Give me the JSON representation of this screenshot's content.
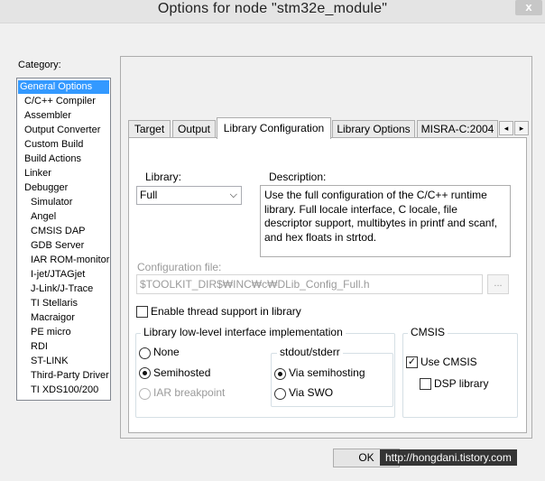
{
  "window": {
    "title": "Options for node \"stm32e_module\"",
    "close_glyph": "x"
  },
  "category": {
    "label": "Category:",
    "items": [
      "General Options",
      "C/C++ Compiler",
      "Assembler",
      "Output Converter",
      "Custom Build",
      "Build Actions",
      "Linker",
      "Debugger",
      "Simulator",
      "Angel",
      "CMSIS DAP",
      "GDB Server",
      "IAR ROM-monitor",
      "I-jet/JTAGjet",
      "J-Link/J-Trace",
      "TI Stellaris",
      "Macraigor",
      "PE micro",
      "RDI",
      "ST-LINK",
      "Third-Party Driver",
      "TI XDS100/200"
    ],
    "selected": "General Options"
  },
  "tabs": {
    "items": [
      "Target",
      "Output",
      "Library Configuration",
      "Library Options",
      "MISRA-C:2004"
    ],
    "active": "Library Configuration",
    "scroll_left": "◂",
    "scroll_right": "▸"
  },
  "library": {
    "label": "Library:",
    "value": "Full",
    "chevron": "⌵"
  },
  "description": {
    "label": "Description:",
    "text": "Use the full configuration of the C/C++ runtime library. Full locale interface, C locale, file descriptor support, multibytes in printf and scanf, and hex floats in strtod."
  },
  "config_file": {
    "label": "Configuration file:",
    "value": "$TOOLKIT_DIR$₩INC₩c₩DLib_Config_Full.h",
    "browse_label": "..."
  },
  "thread_support": {
    "label": "Enable thread support in library",
    "checked": false
  },
  "low_level": {
    "legend": "Library low-level interface implementation",
    "options": [
      "None",
      "Semihosted",
      "IAR breakpoint"
    ],
    "selected": "Semihosted"
  },
  "stdout": {
    "legend": "stdout/stderr",
    "options": [
      "Via semihosting",
      "Via SWO"
    ],
    "selected": "Via semihosting"
  },
  "cmsis": {
    "legend": "CMSIS",
    "use_cmsis_label": "Use CMSIS",
    "use_cmsis_checked": true,
    "dsp_label": "DSP library",
    "dsp_checked": false,
    "check_glyph": "✓"
  },
  "footer": {
    "ok_label": "OK",
    "watermark": "http://hongdani.tistory.com"
  }
}
